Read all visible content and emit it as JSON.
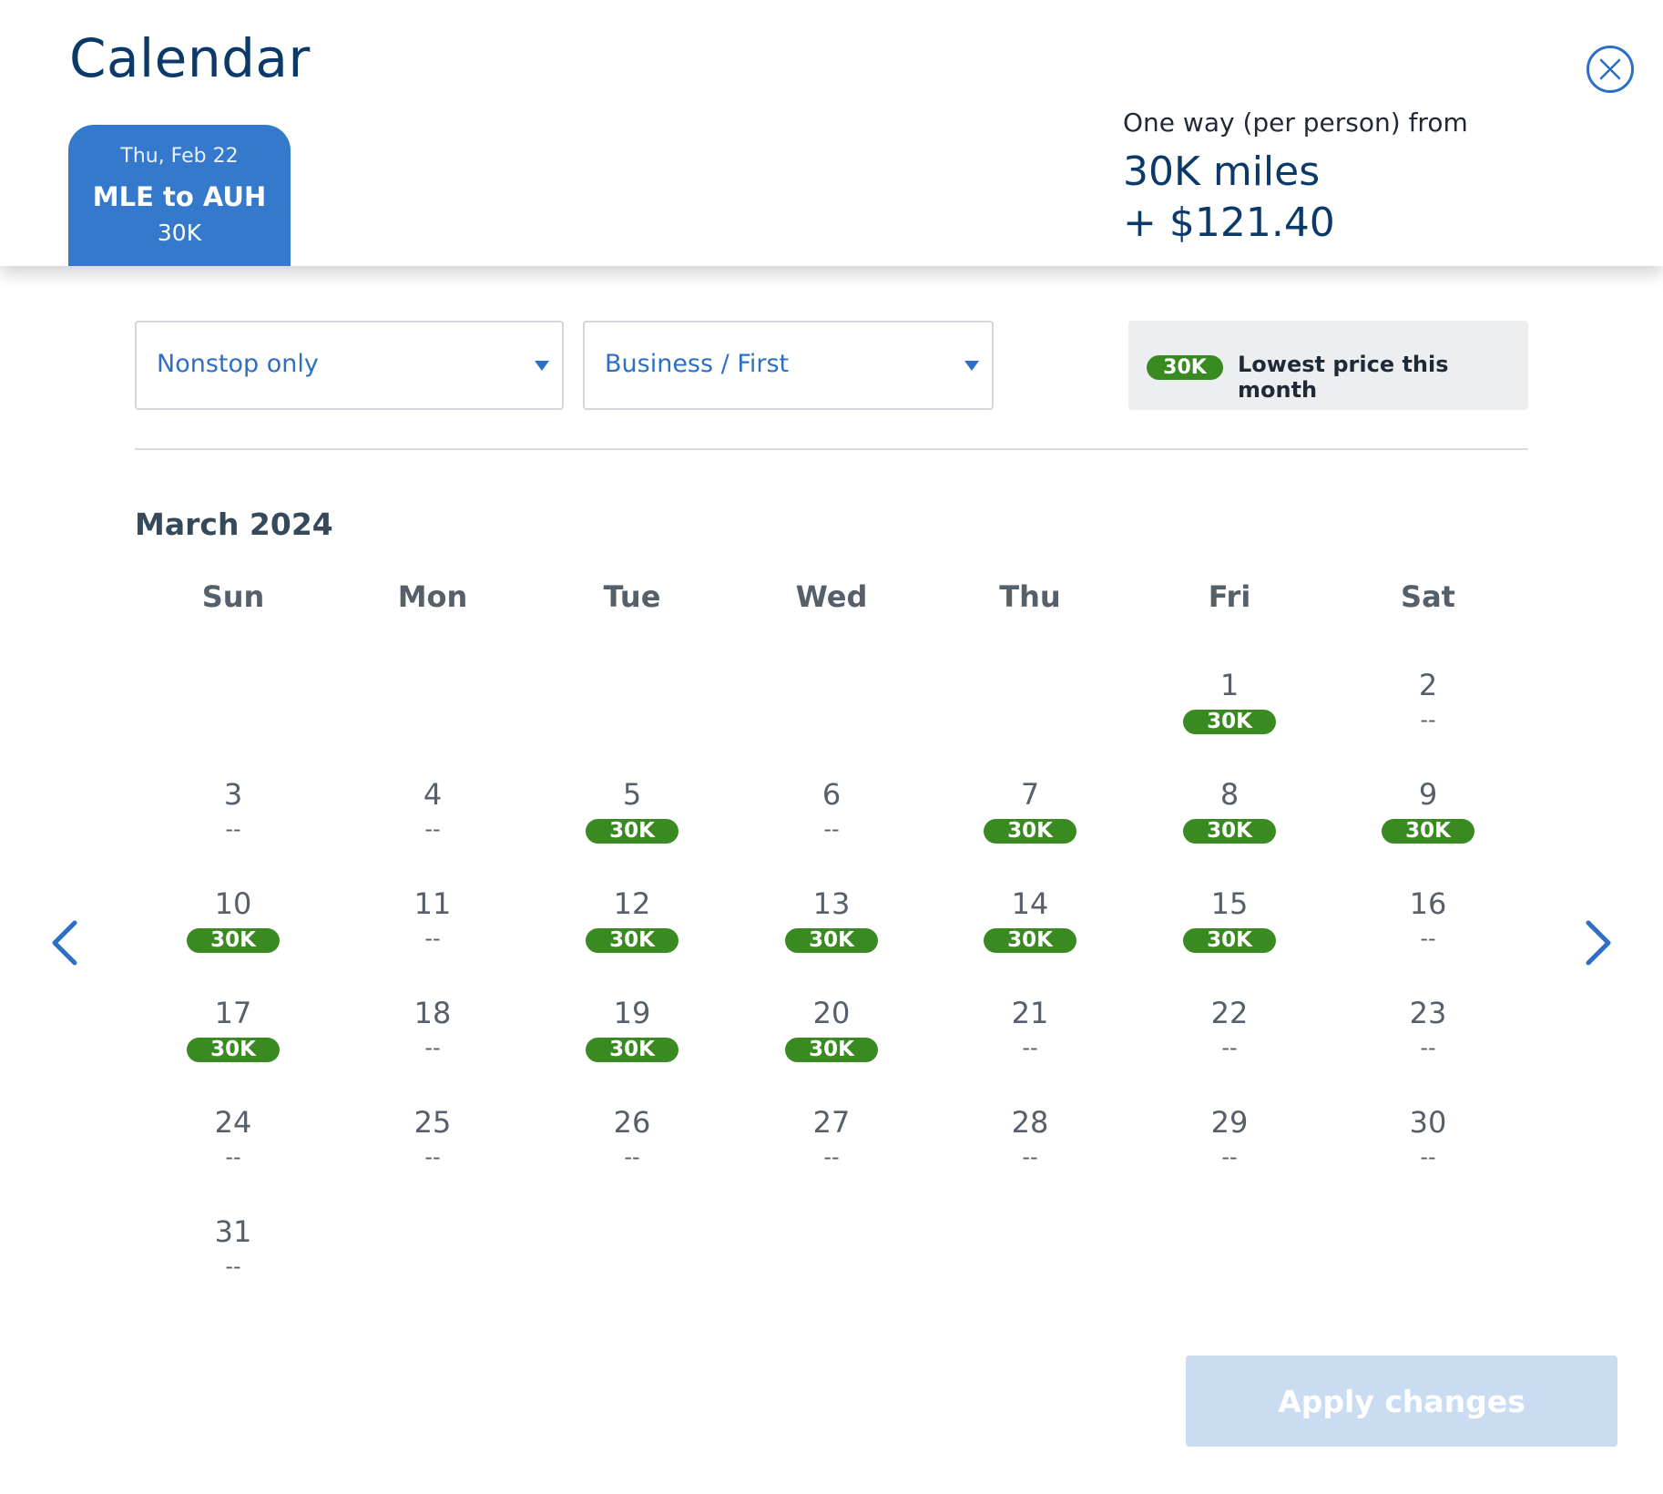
{
  "header": {
    "title": "Calendar",
    "close_icon": "close-circle-icon"
  },
  "flight_tab": {
    "date": "Thu, Feb 22",
    "route": "MLE to AUH",
    "price": "30K"
  },
  "fare_summary": {
    "label": "One way (per person) from",
    "miles": "30K miles",
    "cash": "+ $121.40"
  },
  "filters": {
    "stops": "Nonstop only",
    "cabin": "Business / First"
  },
  "legend": {
    "pill": "30K",
    "text": "Lowest price this month"
  },
  "calendar": {
    "month": "March 2024",
    "weekdays": [
      "Sun",
      "Mon",
      "Tue",
      "Wed",
      "Thu",
      "Fri",
      "Sat"
    ],
    "first_weekday_index": 5,
    "days": [
      {
        "day": "1",
        "price": "30K",
        "lowest": true
      },
      {
        "day": "2",
        "price": "--",
        "lowest": false
      },
      {
        "day": "3",
        "price": "--",
        "lowest": false
      },
      {
        "day": "4",
        "price": "--",
        "lowest": false
      },
      {
        "day": "5",
        "price": "30K",
        "lowest": true
      },
      {
        "day": "6",
        "price": "--",
        "lowest": false
      },
      {
        "day": "7",
        "price": "30K",
        "lowest": true
      },
      {
        "day": "8",
        "price": "30K",
        "lowest": true
      },
      {
        "day": "9",
        "price": "30K",
        "lowest": true
      },
      {
        "day": "10",
        "price": "30K",
        "lowest": true
      },
      {
        "day": "11",
        "price": "--",
        "lowest": false
      },
      {
        "day": "12",
        "price": "30K",
        "lowest": true
      },
      {
        "day": "13",
        "price": "30K",
        "lowest": true
      },
      {
        "day": "14",
        "price": "30K",
        "lowest": true
      },
      {
        "day": "15",
        "price": "30K",
        "lowest": true
      },
      {
        "day": "16",
        "price": "--",
        "lowest": false
      },
      {
        "day": "17",
        "price": "30K",
        "lowest": true
      },
      {
        "day": "18",
        "price": "--",
        "lowest": false
      },
      {
        "day": "19",
        "price": "30K",
        "lowest": true
      },
      {
        "day": "20",
        "price": "30K",
        "lowest": true
      },
      {
        "day": "21",
        "price": "--",
        "lowest": false
      },
      {
        "day": "22",
        "price": "--",
        "lowest": false
      },
      {
        "day": "23",
        "price": "--",
        "lowest": false
      },
      {
        "day": "24",
        "price": "--",
        "lowest": false
      },
      {
        "day": "25",
        "price": "--",
        "lowest": false
      },
      {
        "day": "26",
        "price": "--",
        "lowest": false
      },
      {
        "day": "27",
        "price": "--",
        "lowest": false
      },
      {
        "day": "28",
        "price": "--",
        "lowest": false
      },
      {
        "day": "29",
        "price": "--",
        "lowest": false
      },
      {
        "day": "30",
        "price": "--",
        "lowest": false
      },
      {
        "day": "31",
        "price": "--",
        "lowest": false
      }
    ]
  },
  "navigation": {
    "prev_icon": "chevron-left-icon",
    "next_icon": "chevron-right-icon"
  },
  "footer": {
    "apply_label": "Apply changes"
  },
  "colors": {
    "brand_blue": "#3579cc",
    "navy": "#0b3a6a",
    "link_blue": "#2c6fc5",
    "lowest_green": "#3a8a22",
    "apply_disabled": "#c9dcf2"
  }
}
